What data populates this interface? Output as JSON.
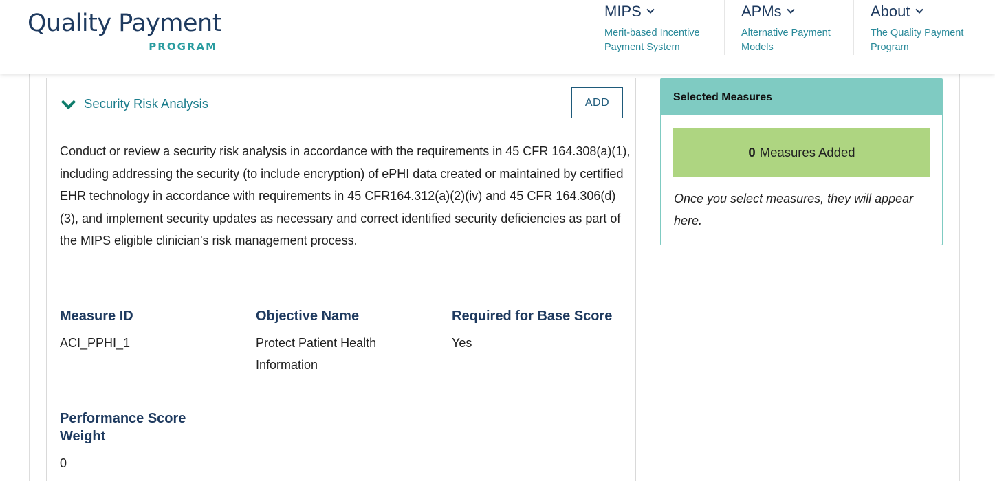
{
  "logo": {
    "main": "Quality Payment",
    "sub": "PROGRAM"
  },
  "nav": [
    {
      "title": "MIPS",
      "desc": "Merit-based Incentive Payment System"
    },
    {
      "title": "APMs",
      "desc": "Alternative Payment Models"
    },
    {
      "title": "About",
      "desc": "The Quality Payment Program"
    }
  ],
  "measure": {
    "title": "Security Risk Analysis",
    "add_label": "ADD",
    "description": "Conduct or review a security risk analysis in accordance with the requirements in 45 CFR 164.308(a)(1), including addressing the security (to include encryption) of ePHI data created or maintained by certified EHR technology in accordance with requirements in 45 CFR164.312(a)(2)(iv) and 45 CFR 164.306(d)(3), and implement security updates as necessary and correct identified security deficiencies as part of the MIPS eligible clinician's risk management process.",
    "fields": [
      {
        "label": "Measure ID",
        "value": "ACI_PPHI_1"
      },
      {
        "label": "Objective Name",
        "value": "Protect Patient Health Information"
      },
      {
        "label": "Required for Base Score",
        "value": "Yes"
      },
      {
        "label": "Performance Score Weight",
        "value": "0"
      }
    ]
  },
  "selected": {
    "heading": "Selected Measures",
    "count": "0",
    "count_label": "Measures Added",
    "note": "Once you select measures, they will appear here."
  },
  "colors": {
    "navy": "#1e3a5f",
    "teal": "#2a9ca0",
    "sidebar_header": "#7fcbc2",
    "count_bg": "#aed581"
  }
}
